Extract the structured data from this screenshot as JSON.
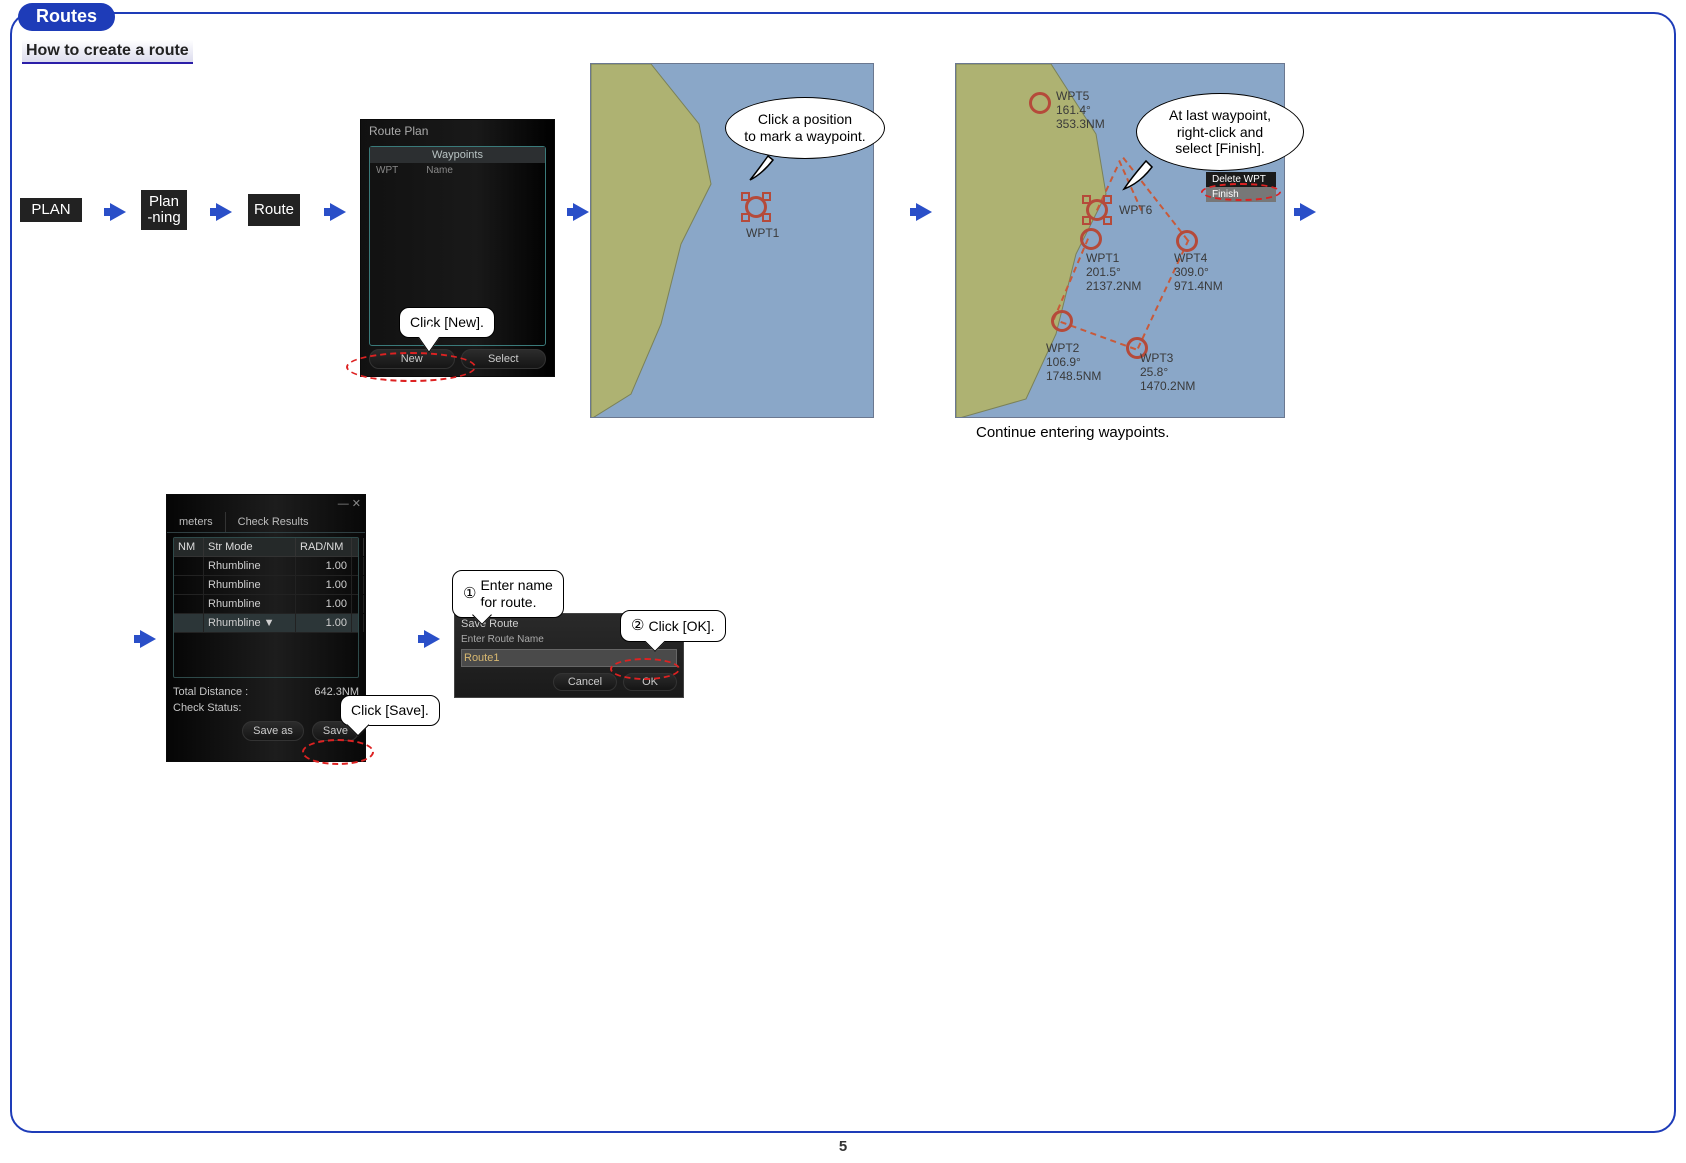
{
  "page_tab": "Routes",
  "sub_header": "How to create a route",
  "page_number": "5",
  "row1": {
    "btn_plan": "PLAN",
    "btn_planning": "Plan\n-ning",
    "btn_route": "Route",
    "routeplan_title": "Route Plan",
    "wp_tab": "Waypoints",
    "wp_head_wpt": "WPT",
    "wp_head_name": "Name",
    "new_btn": "New",
    "select_btn": "Select",
    "callout_new": "Click [New].",
    "map1_callout": "Click a position\nto mark a waypoint.",
    "map1_wpt": "WPT1",
    "map2_callout": "At last waypoint,\nright-click and\nselect [Finish].",
    "ctx_delete": "Delete WPT",
    "ctx_finish": "Finish",
    "map2_caption": "Continue entering waypoints.",
    "waypoints": {
      "wpt1": {
        "name": "WPT1",
        "brg": "201.5°",
        "dist": "2137.2NM"
      },
      "wpt2": {
        "name": "WPT2",
        "brg": "106.9°",
        "dist": "1748.5NM"
      },
      "wpt3": {
        "name": "WPT3",
        "brg": "25.8°",
        "dist": "1470.2NM"
      },
      "wpt4": {
        "name": "WPT4",
        "brg": "309.0°",
        "dist": "971.4NM"
      },
      "wpt5": {
        "name": "WPT5",
        "brg": "161.4°",
        "dist": "353.3NM"
      },
      "wpt6": {
        "name": "WPT6"
      }
    }
  },
  "row2": {
    "tab_meters": "meters",
    "tab_check": "Check Results",
    "col_nm": "NM",
    "col_str": "Str Mode",
    "col_rad": "RAD/NM",
    "rows": [
      {
        "mode": "Rhumbline",
        "rad": "1.00"
      },
      {
        "mode": "Rhumbline",
        "rad": "1.00"
      },
      {
        "mode": "Rhumbline",
        "rad": "1.00"
      },
      {
        "mode": "Rhumbline   ▼",
        "rad": "1.00"
      }
    ],
    "total_label": "Total Distance :",
    "total_val": "642.3NM",
    "check_status": "Check Status:",
    "saveas": "Save as",
    "save": "Save",
    "callout_save": "Click [Save].",
    "dlg_title": "Save Route",
    "dlg_sub": "Enter Route Name",
    "dlg_input": "Route1",
    "dlg_cancel": "Cancel",
    "dlg_ok": "OK",
    "callout_name": "Enter name\nfor route.",
    "callout_ok": "Click [OK].",
    "num1": "①",
    "num2": "②"
  }
}
